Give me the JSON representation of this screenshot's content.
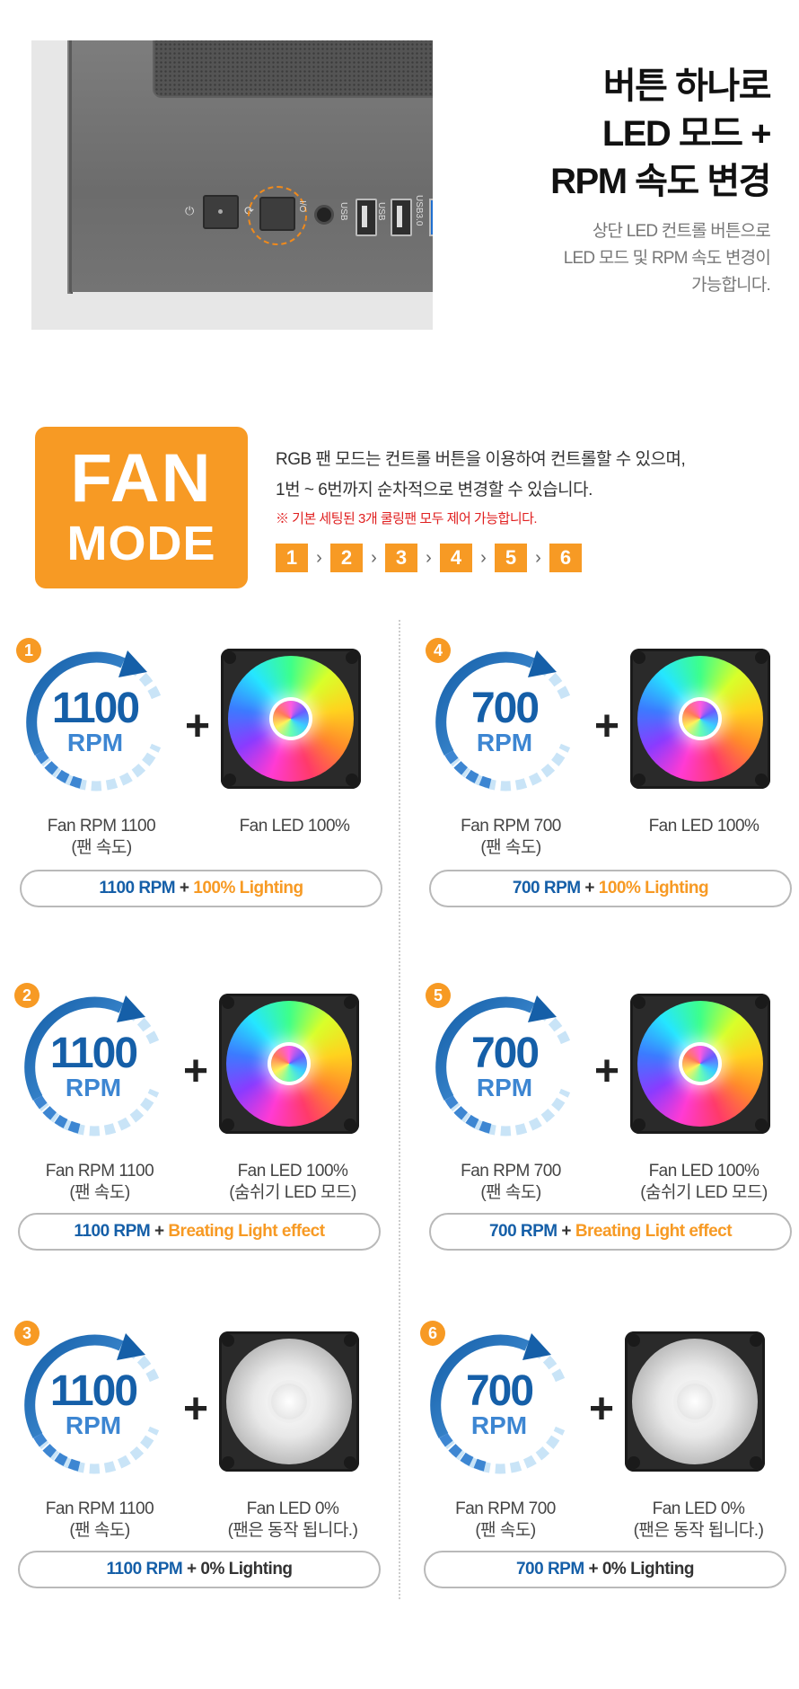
{
  "headline": [
    "버튼 하나로",
    "LED 모드 +",
    "RPM 속도 변경"
  ],
  "subtext": [
    "상단 LED 컨트롤 버튼으로",
    "LED 모드 및 RPM 속도 변경이",
    "가능합니다."
  ],
  "photo": {
    "ports": [
      "USB",
      "USB",
      "USB3.0"
    ],
    "symbol_power": "⏻",
    "symbol_led": "⟳",
    "symbol_io": "I/O"
  },
  "fan_mode": {
    "line1": "FAN",
    "line2": "MODE",
    "desc": [
      "RGB 팬 모드는 컨트롤 버튼을 이용하여 컨트롤할 수 있으며,",
      "1번 ~ 6번까지 순차적으로 변경할 수 있습니다."
    ],
    "note": "※ 기본 세팅된 3개 쿨링팬 모두 제어 가능합니다.",
    "steps": [
      "1",
      "2",
      "3",
      "4",
      "5",
      "6"
    ]
  },
  "modes": [
    {
      "num": "1",
      "rpm": "1100",
      "unit": "RPM",
      "cap_left": [
        "Fan RPM 1100",
        "(팬 속도)"
      ],
      "cap_right": [
        "Fan LED 100%"
      ],
      "pill_rpm": "1100 RPM",
      "pill_plus": "+",
      "pill_light": "100% Lighting",
      "led": "rgb"
    },
    {
      "num": "4",
      "rpm": "700",
      "unit": "RPM",
      "cap_left": [
        "Fan RPM 700",
        "(팬 속도)"
      ],
      "cap_right": [
        "Fan LED 100%"
      ],
      "pill_rpm": "700 RPM",
      "pill_plus": "+",
      "pill_light": "100% Lighting",
      "led": "rgb"
    },
    {
      "num": "2",
      "rpm": "1100",
      "unit": "RPM",
      "cap_left": [
        "Fan RPM 1100",
        "(팬 속도)"
      ],
      "cap_right": [
        "Fan LED 100%",
        "(숨쉬기 LED 모드)"
      ],
      "pill_rpm": "1100 RPM",
      "pill_plus": "+",
      "pill_light": "Breating Light effect",
      "led": "rgb"
    },
    {
      "num": "5",
      "rpm": "700",
      "unit": "RPM",
      "cap_left": [
        "Fan RPM 700",
        "(팬 속도)"
      ],
      "cap_right": [
        "Fan LED 100%",
        "(숨쉬기 LED 모드)"
      ],
      "pill_rpm": "700 RPM",
      "pill_plus": "+",
      "pill_light": "Breating Light effect",
      "led": "rgb"
    },
    {
      "num": "3",
      "rpm": "1100",
      "unit": "RPM",
      "cap_left": [
        "Fan RPM 1100",
        "(팬 속도)"
      ],
      "cap_right": [
        "Fan LED 0%",
        "(팬은 동작 됩니다.)"
      ],
      "pill_rpm": "1100 RPM",
      "pill_plus": "+",
      "pill_light": "0% Lighting",
      "led": "off"
    },
    {
      "num": "6",
      "rpm": "700",
      "unit": "RPM",
      "cap_left": [
        "Fan RPM 700",
        "(팬 속도)"
      ],
      "cap_right": [
        "Fan LED 0%",
        "(팬은 동작 됩니다.)"
      ],
      "pill_rpm": "700 RPM",
      "pill_plus": "+",
      "pill_light": "0% Lighting",
      "led": "off"
    }
  ],
  "colors": {
    "accent": "#f79a24",
    "blue": "#155fa8",
    "light_blue": "#3d86d2",
    "note_red": "#e02020"
  }
}
